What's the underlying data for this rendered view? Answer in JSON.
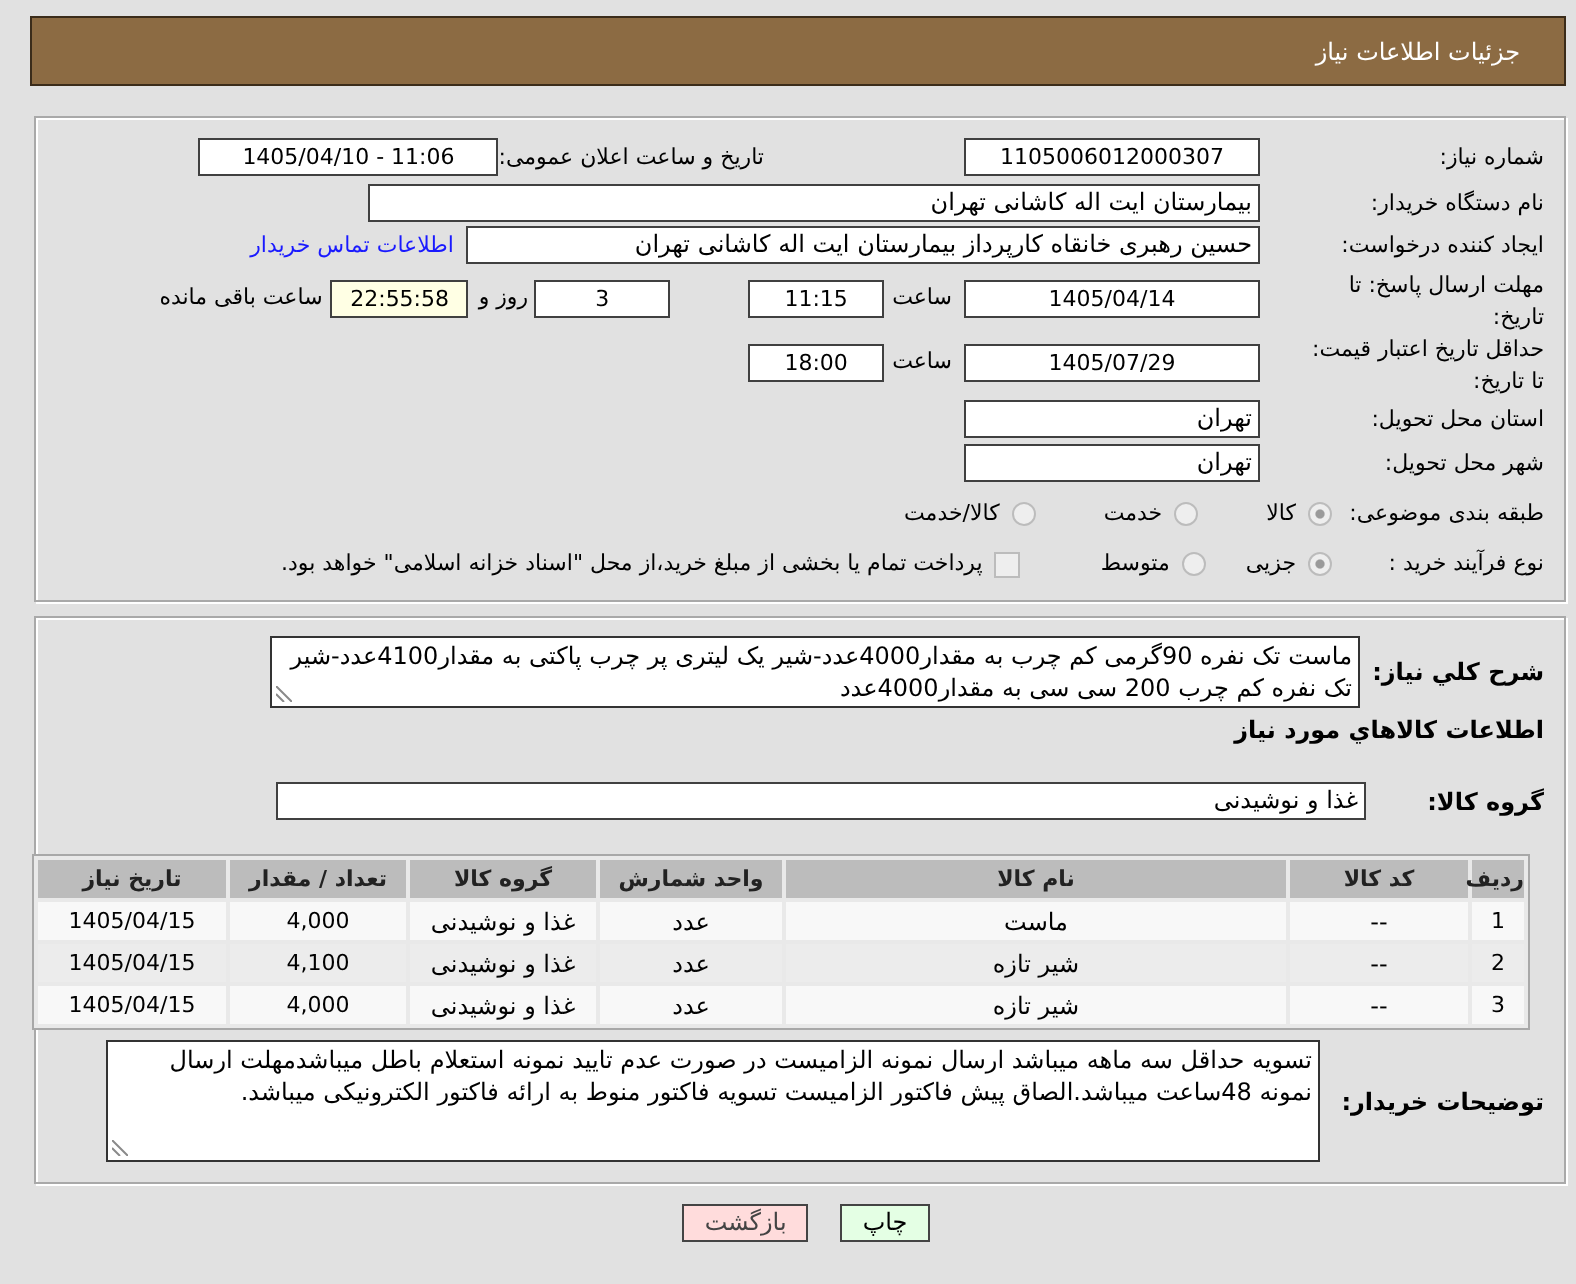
{
  "header": {
    "title": "جزئیات اطلاعات نیاز"
  },
  "details": {
    "need_number": {
      "label": "شماره نیاز:",
      "value": "1105006012000307"
    },
    "announce": {
      "label": "تاریخ و ساعت اعلان عمومی:",
      "value": "1405/04/10 - 11:06"
    },
    "buyer": {
      "label": "نام دستگاه خریدار:",
      "value": "بیمارستان ایت اله کاشانی تهران"
    },
    "requester": {
      "label": "ایجاد کننده درخواست:",
      "value": "حسین رهبری خانقاه کارپرداز بیمارستان ایت اله کاشانی تهران",
      "link": "اطلاعات تماس خریدار"
    },
    "response_deadline": {
      "label": "مهلت ارسال پاسخ: تا تاریخ:",
      "date": "1405/04/14",
      "time_label": "ساعت",
      "time": "11:15",
      "days": "3",
      "days_label": "روز و",
      "remaining": "22:55:58",
      "remaining_label": "ساعت باقی مانده"
    },
    "price_validity": {
      "label": "حداقل تاریخ اعتبار قیمت: تا تاریخ:",
      "date": "1405/07/29",
      "time_label": "ساعت",
      "time": "18:00"
    },
    "province": {
      "label": "استان محل تحویل:",
      "value": "تهران"
    },
    "city": {
      "label": "شهر محل تحویل:",
      "value": "تهران"
    },
    "category": {
      "label": "طبقه بندی موضوعی:",
      "options": [
        {
          "label": "کالا",
          "selected": true,
          "disabled": true
        },
        {
          "label": "خدمت",
          "selected": false,
          "disabled": true
        },
        {
          "label": "کالا/خدمت",
          "selected": false,
          "disabled": true
        }
      ]
    },
    "purchase_type": {
      "label": "نوع فرآیند خرید :",
      "options": [
        {
          "label": "جزیی",
          "selected": true,
          "disabled": true
        },
        {
          "label": "متوسط",
          "selected": false,
          "disabled": true
        }
      ],
      "treasury": {
        "label": "پرداخت تمام یا بخشی از مبلغ خرید،از محل \"اسناد خزانه اسلامی\" خواهد بود.",
        "checked": false,
        "disabled": true
      }
    }
  },
  "needs": {
    "description": {
      "label": "شرح کلي نياز:",
      "value": "ماست تک نفره 90گرمی کم چرب به مقدار4000عدد-شیر یک لیتری پر چرب پاکتی به مقدار4100عدد-شیر تک نفره کم چرب 200 سی سی به مقدار4000عدد"
    },
    "goods_heading": "اطلاعات کالاهاي مورد نياز",
    "goods_group": {
      "label": "گروه کالا:",
      "value": "غذا و نوشیدنی"
    },
    "table": {
      "columns": [
        "ردیف",
        "کد کالا",
        "نام کالا",
        "واحد شمارش",
        "گروه کالا",
        "تعداد / مقدار",
        "تاریخ نیاز"
      ],
      "rows": [
        [
          "1",
          "--",
          "ماست",
          "عدد",
          "غذا و نوشیدنی",
          "4,000",
          "1405/04/15"
        ],
        [
          "2",
          "--",
          "شیر تازه",
          "عدد",
          "غذا و نوشیدنی",
          "4,100",
          "1405/04/15"
        ],
        [
          "3",
          "--",
          "شیر تازه",
          "عدد",
          "غذا و نوشیدنی",
          "4,000",
          "1405/04/15"
        ]
      ]
    },
    "buyer_notes": {
      "label": "توضیحات خریدار:",
      "value": "تسویه حداقل سه ماهه میباشد ارسال نمونه الزامیست در صورت عدم تایید نمونه استعلام باطل میباشدمهلت ارسال نمونه 48ساعت میباشد.الصاق پیش فاکتور الزامیست تسویه فاکتور منوط به ارائه فاکتور الکترونیکی میباشد."
    }
  },
  "buttons": [
    {
      "kind": "print",
      "label": "چاپ"
    },
    {
      "kind": "back",
      "label": "بازگشت"
    }
  ]
}
